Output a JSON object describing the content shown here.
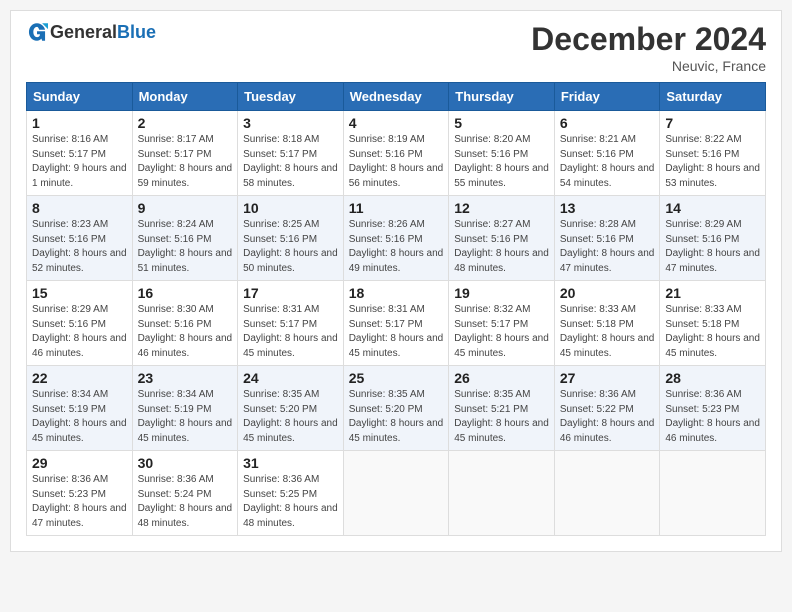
{
  "header": {
    "logo_general": "General",
    "logo_blue": "Blue",
    "month_title": "December 2024",
    "location": "Neuvic, France"
  },
  "weekdays": [
    "Sunday",
    "Monday",
    "Tuesday",
    "Wednesday",
    "Thursday",
    "Friday",
    "Saturday"
  ],
  "weeks": [
    [
      {
        "day": "1",
        "sunrise": "Sunrise: 8:16 AM",
        "sunset": "Sunset: 5:17 PM",
        "daylight": "Daylight: 9 hours and 1 minute."
      },
      {
        "day": "2",
        "sunrise": "Sunrise: 8:17 AM",
        "sunset": "Sunset: 5:17 PM",
        "daylight": "Daylight: 8 hours and 59 minutes."
      },
      {
        "day": "3",
        "sunrise": "Sunrise: 8:18 AM",
        "sunset": "Sunset: 5:17 PM",
        "daylight": "Daylight: 8 hours and 58 minutes."
      },
      {
        "day": "4",
        "sunrise": "Sunrise: 8:19 AM",
        "sunset": "Sunset: 5:16 PM",
        "daylight": "Daylight: 8 hours and 56 minutes."
      },
      {
        "day": "5",
        "sunrise": "Sunrise: 8:20 AM",
        "sunset": "Sunset: 5:16 PM",
        "daylight": "Daylight: 8 hours and 55 minutes."
      },
      {
        "day": "6",
        "sunrise": "Sunrise: 8:21 AM",
        "sunset": "Sunset: 5:16 PM",
        "daylight": "Daylight: 8 hours and 54 minutes."
      },
      {
        "day": "7",
        "sunrise": "Sunrise: 8:22 AM",
        "sunset": "Sunset: 5:16 PM",
        "daylight": "Daylight: 8 hours and 53 minutes."
      }
    ],
    [
      {
        "day": "8",
        "sunrise": "Sunrise: 8:23 AM",
        "sunset": "Sunset: 5:16 PM",
        "daylight": "Daylight: 8 hours and 52 minutes."
      },
      {
        "day": "9",
        "sunrise": "Sunrise: 8:24 AM",
        "sunset": "Sunset: 5:16 PM",
        "daylight": "Daylight: 8 hours and 51 minutes."
      },
      {
        "day": "10",
        "sunrise": "Sunrise: 8:25 AM",
        "sunset": "Sunset: 5:16 PM",
        "daylight": "Daylight: 8 hours and 50 minutes."
      },
      {
        "day": "11",
        "sunrise": "Sunrise: 8:26 AM",
        "sunset": "Sunset: 5:16 PM",
        "daylight": "Daylight: 8 hours and 49 minutes."
      },
      {
        "day": "12",
        "sunrise": "Sunrise: 8:27 AM",
        "sunset": "Sunset: 5:16 PM",
        "daylight": "Daylight: 8 hours and 48 minutes."
      },
      {
        "day": "13",
        "sunrise": "Sunrise: 8:28 AM",
        "sunset": "Sunset: 5:16 PM",
        "daylight": "Daylight: 8 hours and 47 minutes."
      },
      {
        "day": "14",
        "sunrise": "Sunrise: 8:29 AM",
        "sunset": "Sunset: 5:16 PM",
        "daylight": "Daylight: 8 hours and 47 minutes."
      }
    ],
    [
      {
        "day": "15",
        "sunrise": "Sunrise: 8:29 AM",
        "sunset": "Sunset: 5:16 PM",
        "daylight": "Daylight: 8 hours and 46 minutes."
      },
      {
        "day": "16",
        "sunrise": "Sunrise: 8:30 AM",
        "sunset": "Sunset: 5:16 PM",
        "daylight": "Daylight: 8 hours and 46 minutes."
      },
      {
        "day": "17",
        "sunrise": "Sunrise: 8:31 AM",
        "sunset": "Sunset: 5:17 PM",
        "daylight": "Daylight: 8 hours and 45 minutes."
      },
      {
        "day": "18",
        "sunrise": "Sunrise: 8:31 AM",
        "sunset": "Sunset: 5:17 PM",
        "daylight": "Daylight: 8 hours and 45 minutes."
      },
      {
        "day": "19",
        "sunrise": "Sunrise: 8:32 AM",
        "sunset": "Sunset: 5:17 PM",
        "daylight": "Daylight: 8 hours and 45 minutes."
      },
      {
        "day": "20",
        "sunrise": "Sunrise: 8:33 AM",
        "sunset": "Sunset: 5:18 PM",
        "daylight": "Daylight: 8 hours and 45 minutes."
      },
      {
        "day": "21",
        "sunrise": "Sunrise: 8:33 AM",
        "sunset": "Sunset: 5:18 PM",
        "daylight": "Daylight: 8 hours and 45 minutes."
      }
    ],
    [
      {
        "day": "22",
        "sunrise": "Sunrise: 8:34 AM",
        "sunset": "Sunset: 5:19 PM",
        "daylight": "Daylight: 8 hours and 45 minutes."
      },
      {
        "day": "23",
        "sunrise": "Sunrise: 8:34 AM",
        "sunset": "Sunset: 5:19 PM",
        "daylight": "Daylight: 8 hours and 45 minutes."
      },
      {
        "day": "24",
        "sunrise": "Sunrise: 8:35 AM",
        "sunset": "Sunset: 5:20 PM",
        "daylight": "Daylight: 8 hours and 45 minutes."
      },
      {
        "day": "25",
        "sunrise": "Sunrise: 8:35 AM",
        "sunset": "Sunset: 5:20 PM",
        "daylight": "Daylight: 8 hours and 45 minutes."
      },
      {
        "day": "26",
        "sunrise": "Sunrise: 8:35 AM",
        "sunset": "Sunset: 5:21 PM",
        "daylight": "Daylight: 8 hours and 45 minutes."
      },
      {
        "day": "27",
        "sunrise": "Sunrise: 8:36 AM",
        "sunset": "Sunset: 5:22 PM",
        "daylight": "Daylight: 8 hours and 46 minutes."
      },
      {
        "day": "28",
        "sunrise": "Sunrise: 8:36 AM",
        "sunset": "Sunset: 5:23 PM",
        "daylight": "Daylight: 8 hours and 46 minutes."
      }
    ],
    [
      {
        "day": "29",
        "sunrise": "Sunrise: 8:36 AM",
        "sunset": "Sunset: 5:23 PM",
        "daylight": "Daylight: 8 hours and 47 minutes."
      },
      {
        "day": "30",
        "sunrise": "Sunrise: 8:36 AM",
        "sunset": "Sunset: 5:24 PM",
        "daylight": "Daylight: 8 hours and 48 minutes."
      },
      {
        "day": "31",
        "sunrise": "Sunrise: 8:36 AM",
        "sunset": "Sunset: 5:25 PM",
        "daylight": "Daylight: 8 hours and 48 minutes."
      },
      null,
      null,
      null,
      null
    ]
  ]
}
